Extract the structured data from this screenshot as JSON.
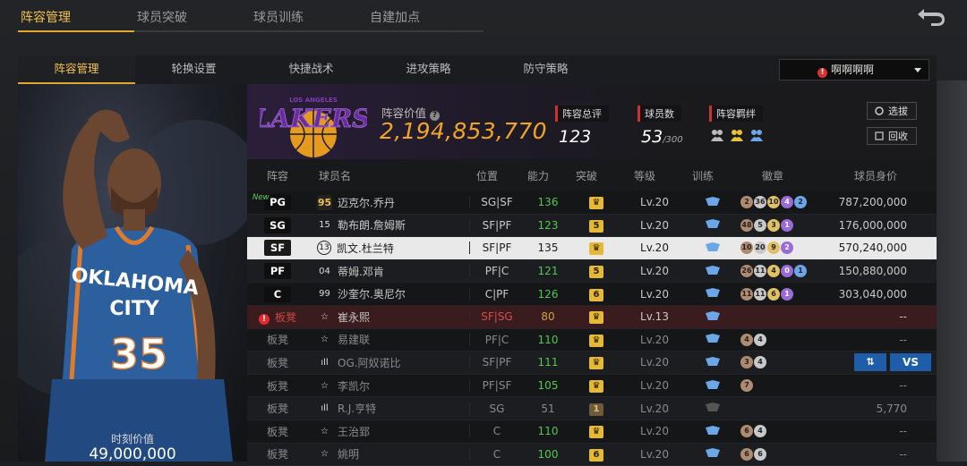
{
  "top_tabs": [
    "阵容管理",
    "球员突破",
    "球员训练",
    "自建加点"
  ],
  "sub_tabs": [
    "阵容管理",
    "轮换设置",
    "快捷战术",
    "进攻策略",
    "防守策略"
  ],
  "dropdown": {
    "label": "啊啊啊啊"
  },
  "player_card": {
    "jersey_team": "OKLAHOMA CITY",
    "jersey_number": "35",
    "value_label": "时刻价值",
    "value": "49,000,000"
  },
  "team": {
    "logo_text": "LAKERS",
    "logo_subtext": "LOS ANGELES",
    "value_label": "阵容价值",
    "value": "2,194,853,770",
    "rating_label": "阵容总评",
    "rating": "123",
    "players_label": "球员数",
    "players": "53",
    "players_max": "/300",
    "bond_label": "阵容羁绊",
    "btn_scout": "选拔",
    "btn_recycle": "回收"
  },
  "table": {
    "headers": [
      "阵容",
      "球员名",
      "位置",
      "能力",
      "突破",
      "等级",
      "训练",
      "徽章",
      "球员身价"
    ],
    "rows": [
      {
        "slot": "PG",
        "new": "New",
        "rating": "95",
        "name": "迈克尔.乔丹",
        "pos": "SG|SF",
        "ability": "136",
        "break": "♛",
        "level": "Lv.20",
        "badges": [
          "2",
          "36",
          "10",
          "4",
          "2"
        ],
        "value": "787,200,000"
      },
      {
        "slot": "SG",
        "rating": "15",
        "name": "勒布朗.詹姆斯",
        "pos": "SF|PF",
        "ability": "123",
        "break": "5",
        "level": "Lv.20",
        "badges": [
          "48",
          "5",
          "3",
          "1"
        ],
        "value": "176,000,000"
      },
      {
        "slot": "SF",
        "rating": "13",
        "name": "凯文.杜兰特",
        "pos": "SF|PF",
        "ability": "135",
        "break": "♛",
        "level": "Lv.20",
        "badges": [
          "10",
          "20",
          "9",
          "2"
        ],
        "value": "570,240,000"
      },
      {
        "slot": "PF",
        "rating": "04",
        "name": "蒂姆.邓肯",
        "pos": "PF|C",
        "ability": "121",
        "break": "5",
        "level": "Lv.20",
        "badges": [
          "26",
          "11",
          "4",
          "0",
          "1"
        ],
        "value": "150,880,000"
      },
      {
        "slot": "C",
        "rating": "99",
        "name": "沙奎尔.奥尼尔",
        "pos": "C|PF",
        "ability": "126",
        "break": "6",
        "level": "Lv.20",
        "badges": [
          "11",
          "11",
          "6",
          "1"
        ],
        "value": "303,040,000"
      },
      {
        "slot": "板凳",
        "warn": "!",
        "rating": "☆",
        "name": "崔永熙",
        "pos": "SF|SG",
        "ability": "80",
        "break": "♛",
        "level": "Lv.13",
        "badges": [],
        "value": "--"
      },
      {
        "slot": "板凳",
        "rating": "☆",
        "name": "易建联",
        "pos": "PF|C",
        "ability": "110",
        "break": "♛",
        "level": "Lv.20",
        "badges": [
          "4",
          "4"
        ],
        "value": "--"
      },
      {
        "slot": "板凳",
        "rating": "ıll",
        "name": "OG.阿奴诺比",
        "pos": "SF|PF",
        "ability": "111",
        "break": "♛",
        "level": "Lv.20",
        "badges": [
          "3",
          "4"
        ],
        "value": "",
        "swap": "⇅",
        "vs": "VS"
      },
      {
        "slot": "板凳",
        "rating": "☆",
        "name": "李凯尔",
        "pos": "PF|SF",
        "ability": "105",
        "break": "♛",
        "level": "Lv.20",
        "badges": [
          "7"
        ],
        "value": "--"
      },
      {
        "slot": "板凳",
        "rating": "ıll",
        "name": "R.J.亨特",
        "pos": "SG",
        "ability": "51",
        "break": "1",
        "level": "Lv.20",
        "badges": [],
        "value": "5,770"
      },
      {
        "slot": "板凳",
        "rating": "☆",
        "name": "王治郅",
        "pos": "C",
        "ability": "110",
        "break": "♛",
        "level": "Lv.20",
        "badges": [
          "6",
          "4"
        ],
        "value": "--"
      },
      {
        "slot": "板凳",
        "rating": "☆",
        "name": "姚明",
        "pos": "C",
        "ability": "100",
        "break": "6",
        "level": "Lv.20",
        "badges": [
          "6",
          "6"
        ],
        "value": "--"
      }
    ]
  },
  "colors": {
    "accent": "#f2c14e",
    "value_orange": "#f0a524",
    "green": "#53c653",
    "red": "#d84a4a",
    "swap_blue": "#1e5ea8"
  }
}
